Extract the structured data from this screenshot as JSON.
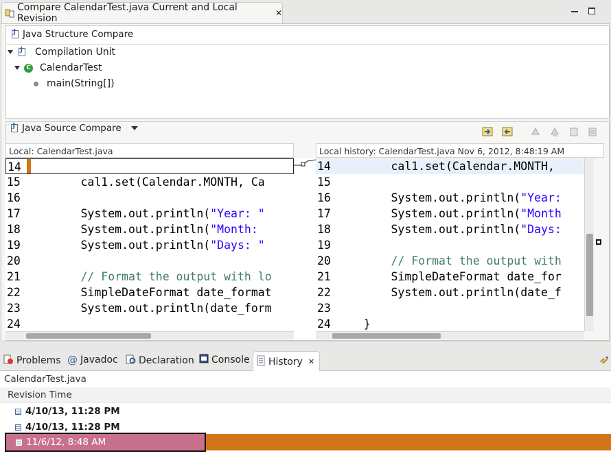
{
  "editor": {
    "tab_title": "Compare CalendarTest.java Current and Local Revision"
  },
  "structure": {
    "title": "Java Structure Compare",
    "tree": {
      "root": "Compilation Unit",
      "class": "CalendarTest",
      "method": "main(String[])"
    }
  },
  "source": {
    "title": "Java Source Compare",
    "left_header": "Local: CalendarTest.java",
    "right_header": "Local history: CalendarTest.java Nov 6, 2012, 8:48:19 AM",
    "left_lines": [
      {
        "n": "14",
        "parts": [
          {
            "t": ""
          }
        ]
      },
      {
        "n": "15",
        "parts": [
          {
            "t": "        cal1.set(Calendar.MONTH, Ca"
          }
        ]
      },
      {
        "n": "16",
        "parts": [
          {
            "t": ""
          }
        ]
      },
      {
        "n": "17",
        "parts": [
          {
            "t": "        System.out.println("
          },
          {
            "t": "\"Year: \"",
            "c": "str"
          }
        ]
      },
      {
        "n": "18",
        "parts": [
          {
            "t": "        System.out.println("
          },
          {
            "t": "\"Month: ",
            "c": "str"
          }
        ]
      },
      {
        "n": "19",
        "parts": [
          {
            "t": "        System.out.println("
          },
          {
            "t": "\"Days: \"",
            "c": "str"
          }
        ]
      },
      {
        "n": "20",
        "parts": [
          {
            "t": ""
          }
        ]
      },
      {
        "n": "21",
        "parts": [
          {
            "t": "        "
          },
          {
            "t": "// Format the output with lo",
            "c": "cmt"
          }
        ]
      },
      {
        "n": "22",
        "parts": [
          {
            "t": "        SimpleDateFormat date_format"
          }
        ]
      },
      {
        "n": "23",
        "parts": [
          {
            "t": "        System.out.println(date_form"
          }
        ]
      },
      {
        "n": "24",
        "parts": [
          {
            "t": ""
          }
        ]
      }
    ],
    "right_lines": [
      {
        "n": "14",
        "parts": [
          {
            "t": "        cal1.set(Calendar.MONTH, "
          }
        ]
      },
      {
        "n": "15",
        "parts": [
          {
            "t": ""
          }
        ]
      },
      {
        "n": "16",
        "parts": [
          {
            "t": "        System.out.println("
          },
          {
            "t": "\"Year:",
            "c": "str"
          }
        ]
      },
      {
        "n": "17",
        "parts": [
          {
            "t": "        System.out.println("
          },
          {
            "t": "\"Month",
            "c": "str"
          }
        ]
      },
      {
        "n": "18",
        "parts": [
          {
            "t": "        System.out.println("
          },
          {
            "t": "\"Days:",
            "c": "str"
          }
        ]
      },
      {
        "n": "19",
        "parts": [
          {
            "t": ""
          }
        ]
      },
      {
        "n": "20",
        "parts": [
          {
            "t": "        "
          },
          {
            "t": "// Format the output with",
            "c": "cmt"
          }
        ]
      },
      {
        "n": "21",
        "parts": [
          {
            "t": "        SimpleDateFormat date_for"
          }
        ]
      },
      {
        "n": "22",
        "parts": [
          {
            "t": "        System.out.println(date_f"
          }
        ]
      },
      {
        "n": "23",
        "parts": [
          {
            "t": ""
          }
        ]
      },
      {
        "n": "24",
        "parts": [
          {
            "t": "    }"
          }
        ]
      }
    ]
  },
  "bottom_tabs": {
    "problems": "Problems",
    "javadoc": "Javadoc",
    "declaration": "Declaration",
    "console": "Console",
    "history": "History"
  },
  "history": {
    "file": "CalendarTest.java",
    "column": "Revision Time",
    "rows": [
      "4/10/13, 11:28 PM",
      "4/10/13, 11:28 PM",
      "11/6/12, 8:48 AM"
    ]
  },
  "colors": {
    "change_marker": "#d4741a",
    "selection": "#c9718c",
    "string": "#2a00ff",
    "comment": "#3f7f5f"
  }
}
